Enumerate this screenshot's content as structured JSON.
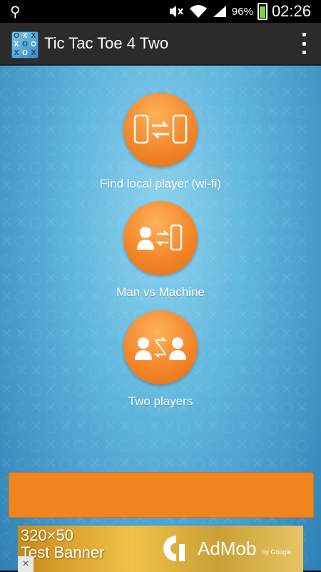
{
  "status_bar": {
    "battery_percent": "96%",
    "time": "02:26"
  },
  "app": {
    "title": "Tic Tac Toe 4 Two"
  },
  "menu": {
    "items": [
      {
        "label": "Find local player (wi-fi)",
        "icon": "phone-transfer-icon"
      },
      {
        "label": "Man vs Machine",
        "icon": "person-phone-icon"
      },
      {
        "label": "Two players",
        "icon": "two-persons-icon"
      }
    ]
  },
  "ad": {
    "line1": "320×50",
    "line2": "Test Banner",
    "brand": "AdMob",
    "by": "by Google",
    "close": "×"
  },
  "colors": {
    "accent": "#f4862a",
    "background": "#5fb6dd",
    "action_bar": "#2b2b2b"
  }
}
